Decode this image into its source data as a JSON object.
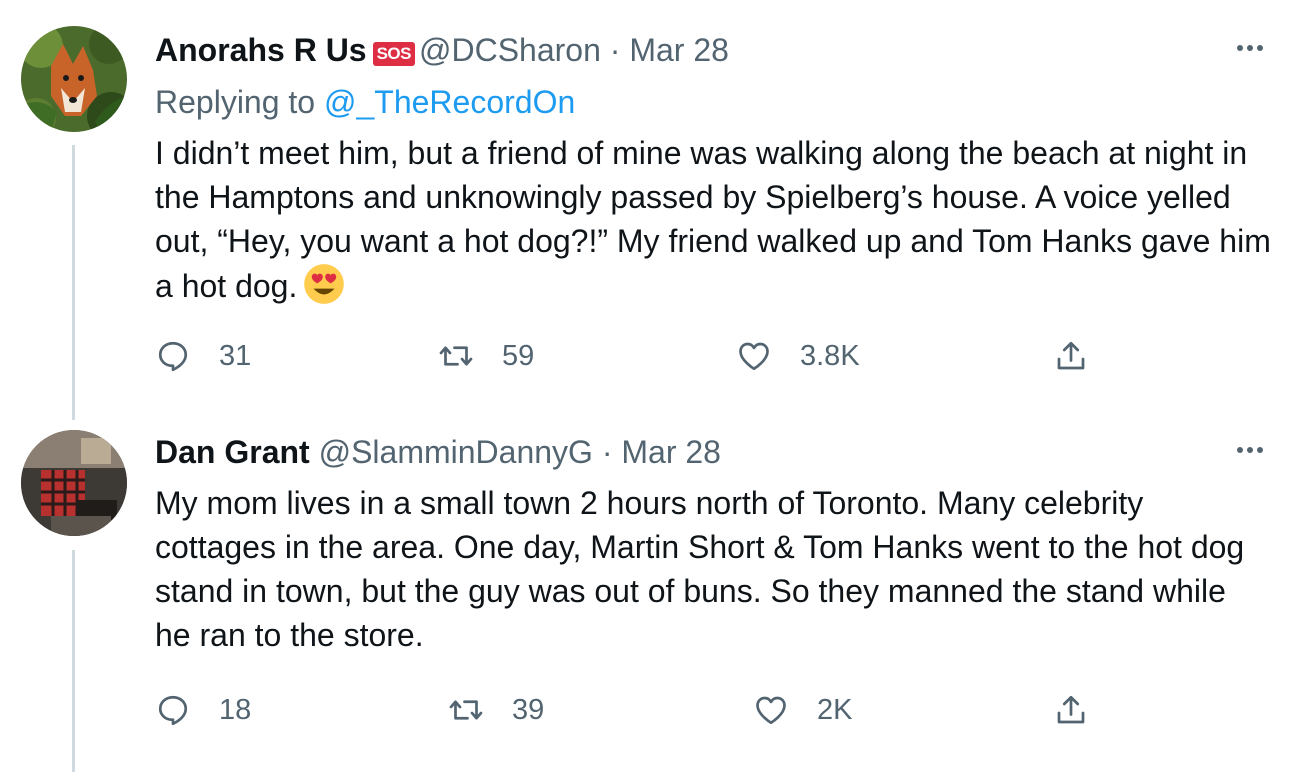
{
  "tweets": [
    {
      "author_name": "Anorahs R Us",
      "badge": "SOS",
      "handle": "@DCSharon",
      "separator": "·",
      "date": "Mar 28",
      "replying_prefix": "Replying to",
      "replying_to": "@_TheRecordOn",
      "text": "I didn’t meet him, but a friend of mine was walking along the beach at night in the Hamptons and unknowingly passed by Spielberg’s house. A voice yelled out, “Hey, you want a hot dog?!” My friend walked up and Tom Hanks gave him a hot dog.",
      "reply_count": "31",
      "retweet_count": "59",
      "like_count": "3.8K"
    },
    {
      "author_name": "Dan Grant",
      "handle": "@SlamminDannyG",
      "separator": "·",
      "date": "Mar 28",
      "text": "My mom lives in a small town 2 hours north of Toronto. Many celebrity cottages in the area. One day, Martin Short & Tom Hanks went to the hot dog stand in town, but the guy was out of buns. So they manned the stand while he ran to the store.",
      "reply_count": "18",
      "retweet_count": "39",
      "like_count": "2K"
    }
  ],
  "icons": {
    "reply": "speech-bubble-icon",
    "retweet": "retweet-arrows-icon",
    "like": "heart-outline-icon",
    "share": "share-upload-icon",
    "more": "three-dots-icon",
    "emoji": "heart-eyes-emoji"
  },
  "colors": {
    "text": "#0f1419",
    "secondary": "#536471",
    "link": "#1d9bf0",
    "thread_line": "#cfd9de",
    "sos_badge": "#dd2e44"
  }
}
